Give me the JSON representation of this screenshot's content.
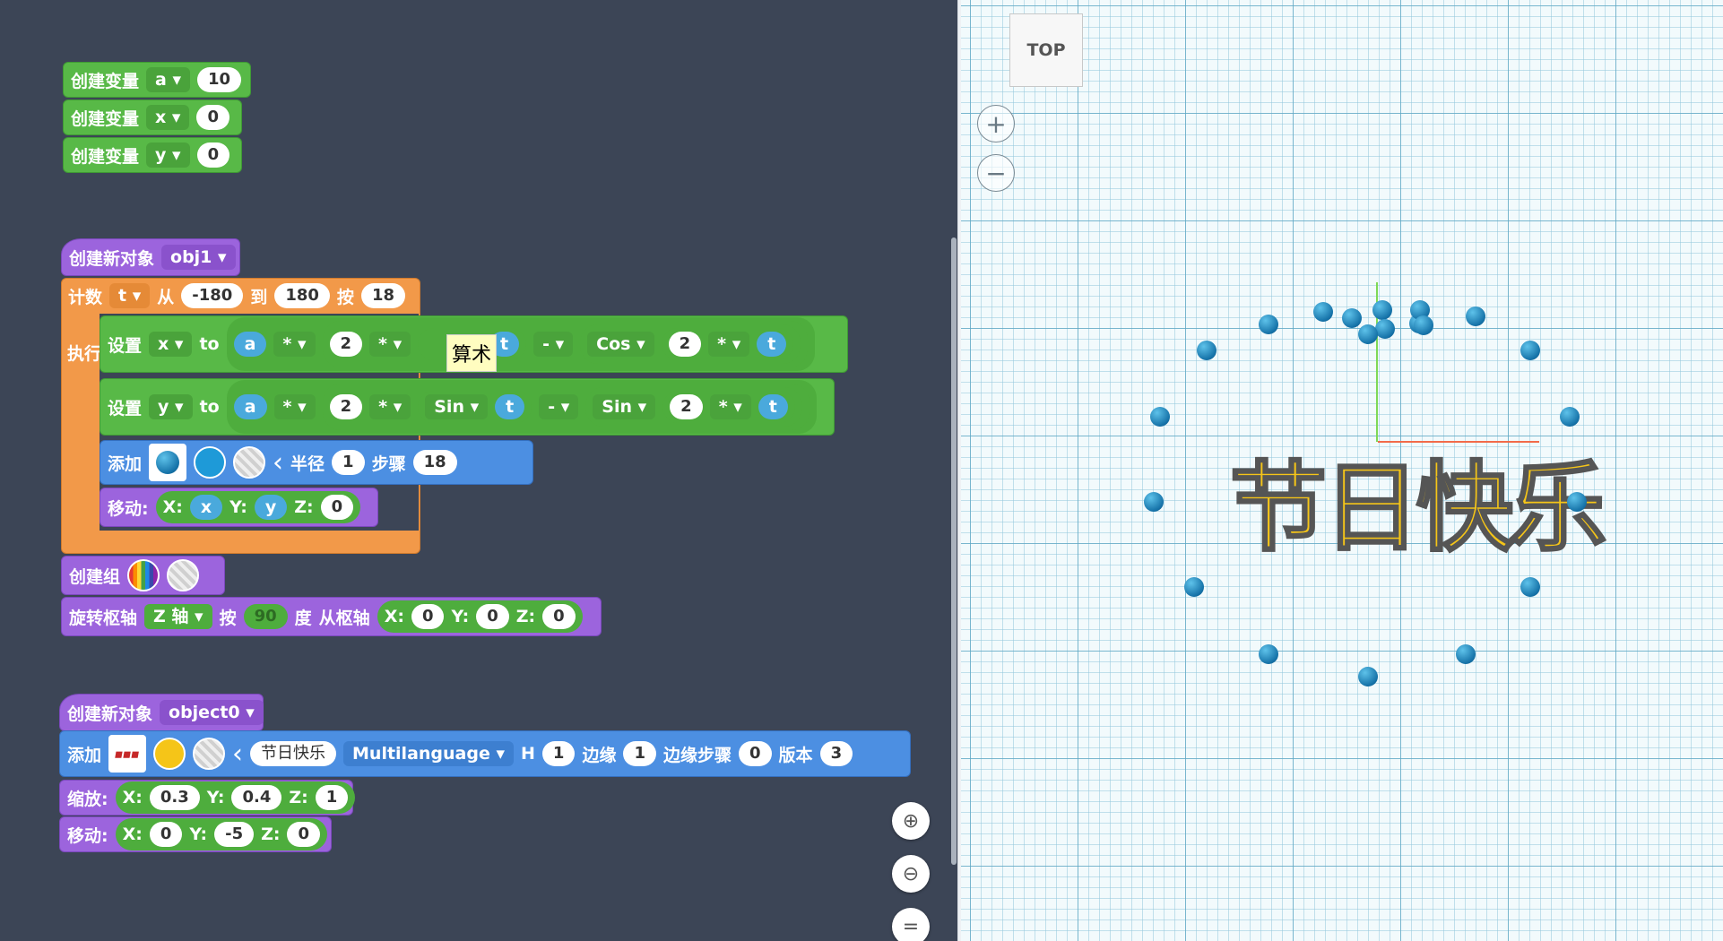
{
  "vars": [
    {
      "label": "创建变量",
      "name": "a",
      "value": "10"
    },
    {
      "label": "创建变量",
      "name": "x",
      "value": "0"
    },
    {
      "label": "创建变量",
      "name": "y",
      "value": "0"
    }
  ],
  "obj1": {
    "hat_label": "创建新对象",
    "name": "obj1",
    "loop": {
      "label": "计数",
      "var": "t",
      "from_label": "从",
      "from": "-180",
      "to_label": "到",
      "to": "180",
      "step_label": "按",
      "step": "18",
      "do_label": "执行"
    },
    "set_x": {
      "label": "设置",
      "var": "x",
      "to": "to",
      "a": "a",
      "op1": "*",
      "n1": "2",
      "op2": "*",
      "t1": "t",
      "minus": "-",
      "func": "Cos",
      "n2": "2",
      "op3": "*",
      "t2": "t"
    },
    "set_y": {
      "label": "设置",
      "var": "y",
      "to": "to",
      "a": "a",
      "op1": "*",
      "n1": "2",
      "op2": "*",
      "func1": "Sin",
      "t1": "t",
      "minus": "-",
      "func2": "Sin",
      "n2": "2",
      "op3": "*",
      "t2": "t"
    },
    "add": {
      "label": "添加",
      "radius_label": "半径",
      "radius": "1",
      "steps_label": "步骤",
      "steps": "18",
      "color": "#1e9ad8"
    },
    "move": {
      "label": "移动:",
      "x_label": "X:",
      "x": "x",
      "y_label": "Y:",
      "y": "y",
      "z_label": "Z:",
      "z": "0"
    },
    "group_label": "创建组",
    "rotate": {
      "label": "旋转枢轴",
      "axis": "Z 轴",
      "by": "按",
      "deg": "90",
      "deg_label": "度",
      "from_label": "从枢轴",
      "x_label": "X:",
      "x": "0",
      "y_label": "Y:",
      "y": "0",
      "z_label": "Z:",
      "z": "0"
    }
  },
  "tooltip": "算术",
  "obj0": {
    "hat_label": "创建新对象",
    "name": "object0",
    "add": {
      "label": "添加",
      "text": "节日快乐",
      "font": "Multilanguage",
      "h_label": "H",
      "h": "1",
      "edge_label": "边缘",
      "edge": "1",
      "edge_step_label": "边缘步骤",
      "edge_step": "0",
      "ver_label": "版本",
      "ver": "3",
      "color": "#f5c518"
    },
    "scale": {
      "label": "缩放:",
      "x_label": "X:",
      "x": "0.3",
      "y_label": "Y:",
      "y": "0.4",
      "z_label": "Z:",
      "z": "1"
    },
    "move": {
      "label": "移动:",
      "x_label": "X:",
      "x": "0",
      "y_label": "Y:",
      "y": "-5",
      "z_label": "Z:",
      "z": "0"
    }
  },
  "viewport": {
    "view_label": "TOP",
    "text": "节日快乐",
    "zoom_in": "+",
    "zoom_out": "−"
  },
  "workspace_controls": {
    "zoom_in": "⊕",
    "zoom_out": "⊖",
    "reset": "="
  }
}
